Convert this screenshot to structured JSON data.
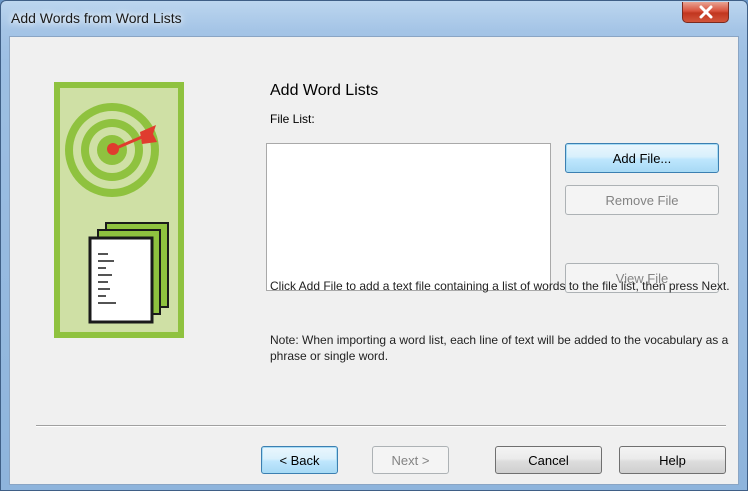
{
  "window": {
    "title": "Add Words from Word Lists"
  },
  "page": {
    "heading": "Add Word Lists",
    "file_list_label": "File List:",
    "file_list_items": [],
    "info_text": "Click Add File to add a text file containing a list of words to the file list, then press Next.",
    "note_text": "Note: When importing a word list, each line of text will be added to the vocabulary as a phrase or single word."
  },
  "buttons": {
    "add_file": "Add File...",
    "remove_file": "Remove File",
    "view_file": "View File",
    "back": "< Back",
    "next": "Next >",
    "cancel": "Cancel",
    "help": "Help"
  },
  "icons": {
    "close": "close-icon",
    "illustration": "target-and-documents-icon"
  },
  "colors": {
    "title_bar": "#a4c4e6",
    "close_button": "#c1361f",
    "illustration_frame": "#8fc23f",
    "illustration_fill": "#cfe0a5",
    "dart": "#e03c2e"
  }
}
